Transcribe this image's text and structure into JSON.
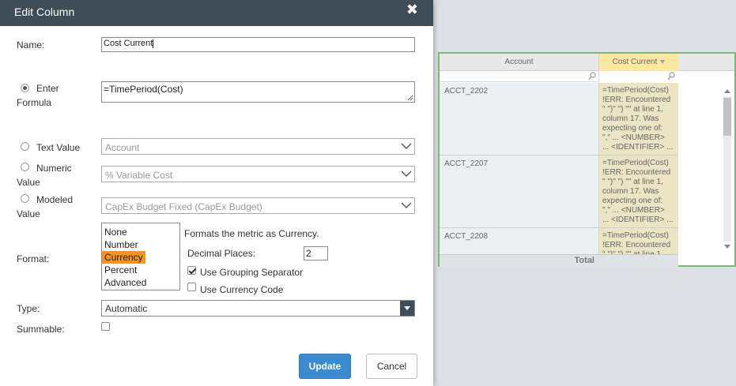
{
  "dialog": {
    "title": "Edit Column",
    "close_glyph": "✖",
    "name_label": "Name:",
    "name_value": "Cost Current",
    "enter_formula_label_1": "Enter",
    "enter_formula_label_2": "Formula",
    "formula_value": "=TimePeriod(Cost)",
    "text_value_label": "Text Value",
    "text_value_select": "Account",
    "numeric_value_label_1": "Numeric",
    "numeric_value_label_2": "Value",
    "numeric_value_select": "% Variable Cost",
    "modeled_value_label_1": "Modeled",
    "modeled_value_label_2": "Value",
    "modeled_value_select": "CapEx Budget Fixed (CapEx Budget)",
    "format_label": "Format:",
    "format_options": [
      "None",
      "Number",
      "Currency",
      "Percent",
      "Advanced"
    ],
    "format_selected": "Currency",
    "format_description": "Formats the metric as Currency.",
    "decimal_places_label": "Decimal Places:",
    "decimal_places_value": "2",
    "use_grouping_label": "Use Grouping Separator",
    "use_grouping_checked": true,
    "use_currency_code_label": "Use Currency Code",
    "use_currency_code_checked": false,
    "type_label": "Type:",
    "type_value": "Automatic",
    "summable_label": "Summable:",
    "summable_checked": false,
    "update_label": "Update",
    "cancel_label": "Cancel"
  },
  "grid": {
    "col_account": "Account",
    "col_cost": "Cost Current",
    "rows": [
      {
        "account": "ACCT_2202",
        "cost": "=TimePeriod(Cost)\n!ERR: Encountered\n\" \")\" \") \"\" at line 1,\ncolumn 17. Was\nexpecting one of:\n\",\" ... <NUMBER>\n... <IDENTIFIER> ..."
      },
      {
        "account": "ACCT_2207",
        "cost": "=TimePeriod(Cost)\n!ERR: Encountered\n\" \")\" \") \"\" at line 1,\ncolumn 17. Was\nexpecting one of:\n\",\" ... <NUMBER>\n... <IDENTIFIER> ..."
      },
      {
        "account": "ACCT_2208",
        "cost": "=TimePeriod(Cost)\n!ERR: Encountered\n\" \")\" \") \"\" at line 1,"
      }
    ],
    "total_label": "Total"
  },
  "colors": {
    "header_bg": "#3e4d58",
    "update_btn": "#3b8bd0",
    "selected_format": "#f7931e",
    "grid_border": "#7cb87a",
    "cost_header": "#fce8a0"
  }
}
